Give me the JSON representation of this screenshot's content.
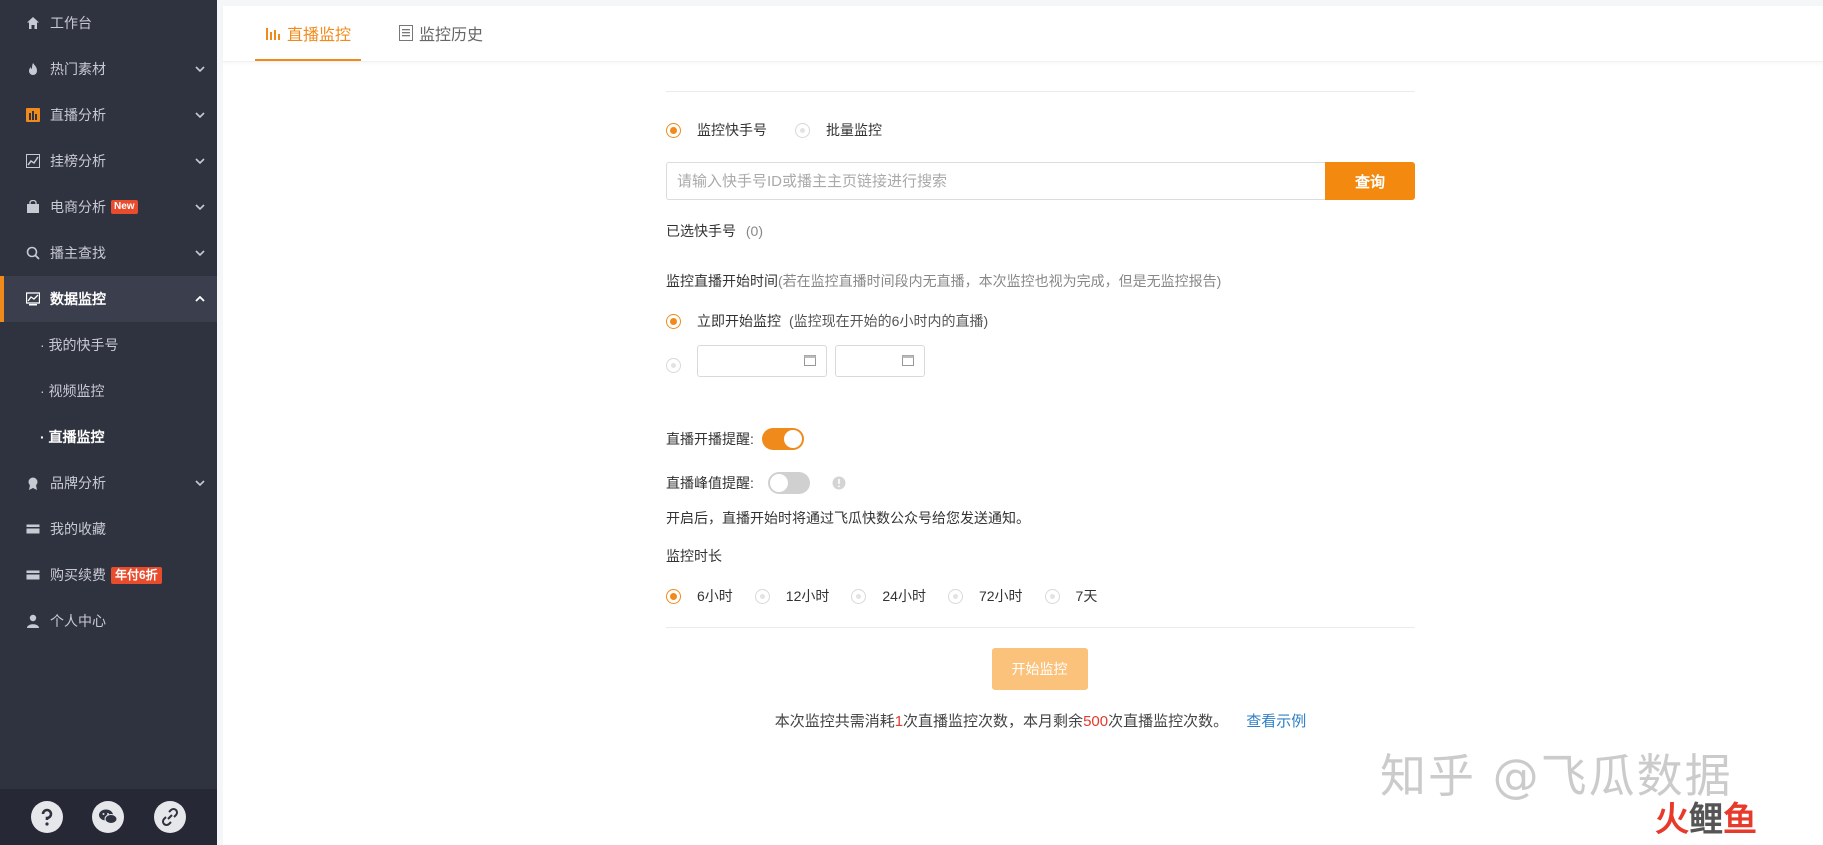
{
  "sidebar": {
    "items": [
      {
        "label": "工作台",
        "icon": "home-icon"
      },
      {
        "label": "热门素材",
        "icon": "fire-icon"
      },
      {
        "label": "直播分析",
        "icon": "bar-chart-icon"
      },
      {
        "label": "挂榜分析",
        "icon": "trend-icon"
      },
      {
        "label": "电商分析",
        "icon": "shop-bag-icon",
        "badge": "New"
      },
      {
        "label": "播主查找",
        "icon": "search-icon"
      },
      {
        "label": "数据监控",
        "icon": "monitor-icon"
      },
      {
        "label": "品牌分析",
        "icon": "brand-icon"
      },
      {
        "label": "我的收藏",
        "icon": "card-icon"
      },
      {
        "label": "购买续费",
        "icon": "card-icon",
        "badge": "年付6折"
      },
      {
        "label": "个人中心",
        "icon": "user-icon"
      }
    ],
    "sub_items": [
      "· 我的快手号",
      "· 视频监控",
      "· 直播监控"
    ],
    "footer_icons": [
      "help-icon",
      "wechat-icon",
      "link-icon"
    ]
  },
  "tabs": [
    {
      "label": "直播监控",
      "icon": "bar-chart-icon"
    },
    {
      "label": "监控历史",
      "icon": "document-icon"
    }
  ],
  "form": {
    "mode_options": [
      "监控快手号",
      "批量监控"
    ],
    "search": {
      "placeholder": "请输入快手号ID或播主主页链接进行搜索",
      "button": "查询"
    },
    "selected_label": "已选快手号",
    "selected_count": "(0)",
    "start_time": {
      "title": "监控直播开始时间",
      "note": "(若在监控直播时间段内无直播，本次监控也视为完成，但是无监控报告)",
      "option_now": "立即开始监控",
      "option_now_note": "(监控现在开始的6小时内的直播)"
    },
    "live_start_alert": {
      "label": "直播开播提醒:",
      "enabled": true
    },
    "peak_alert": {
      "label": "直播峰值提醒:",
      "enabled": false
    },
    "notice": "开启后，直播开始时将通过飞瓜快数公众号给您发送通知。",
    "duration": {
      "title": "监控时长",
      "options": [
        "6小时",
        "12小时",
        "24小时",
        "72小时",
        "7天"
      ],
      "selected": "6小时"
    },
    "start_button": "开始监控",
    "footer": {
      "part1": "本次监控共需消耗",
      "count1": "1",
      "part2": "次直播监控次数，本月剩余",
      "count2": "500",
      "part3": "次直播监控次数。",
      "link": "查看示例"
    }
  },
  "watermark": {
    "text": "知乎 @飞瓜数据",
    "logo_a": "火",
    "logo_b": "鲤",
    "logo_c": "鱼"
  },
  "colors": {
    "accent": "#f08b1b",
    "sidebar_bg": "#2f323f",
    "badge_red": "#e84c2c"
  }
}
